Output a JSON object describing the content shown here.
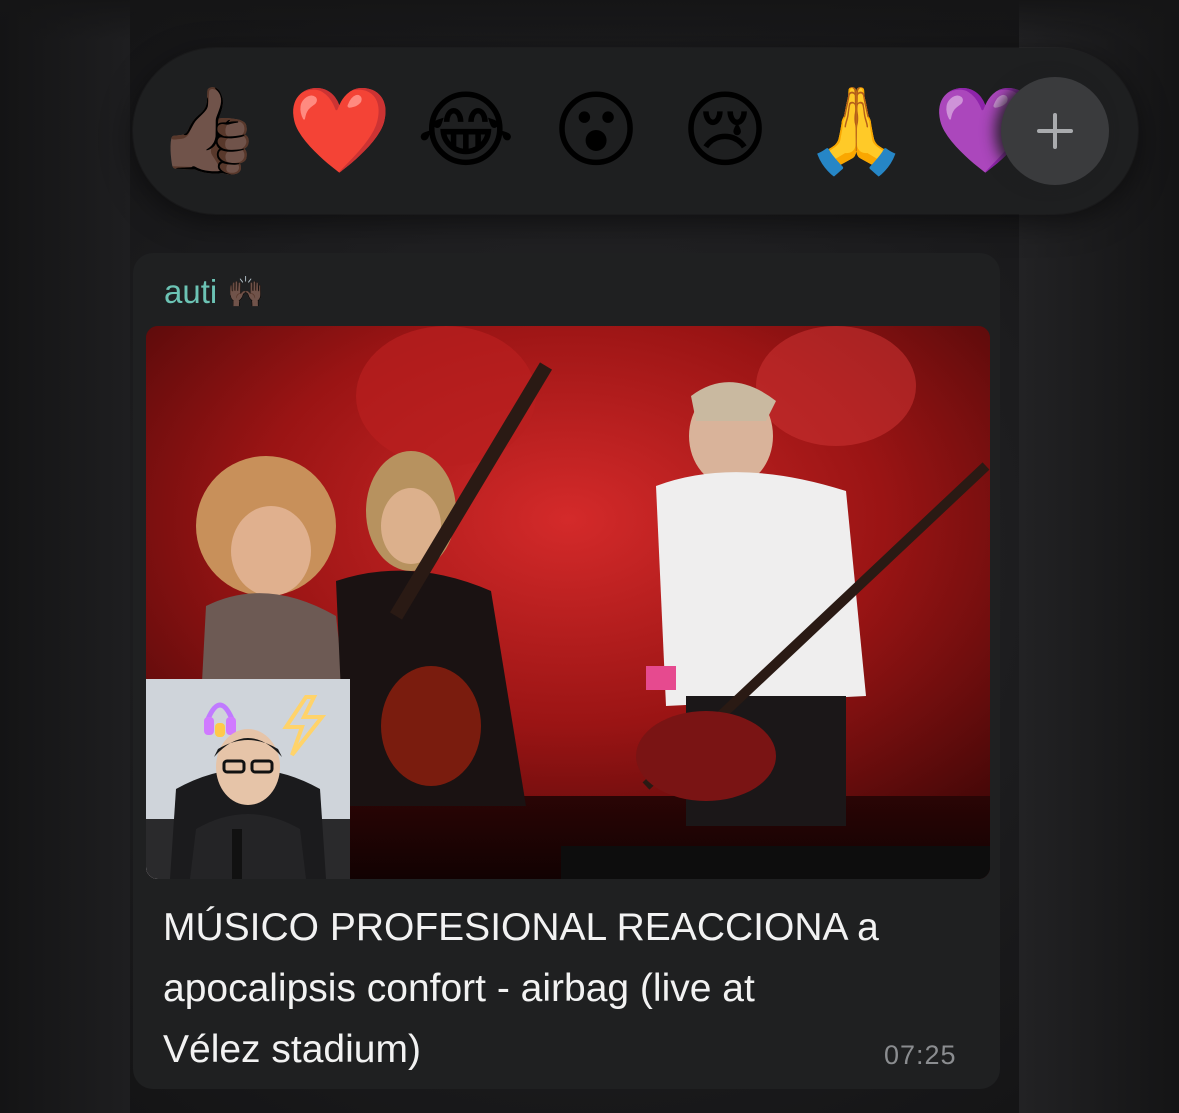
{
  "reaction_bar": {
    "reactions": [
      {
        "emoji": "👍🏿",
        "name": "thumbs-up"
      },
      {
        "emoji": "❤️",
        "name": "red-heart"
      },
      {
        "emoji": "😂",
        "name": "tears-of-joy"
      },
      {
        "emoji": "😮",
        "name": "surprised"
      },
      {
        "emoji": "😢",
        "name": "crying"
      },
      {
        "emoji": "🙏",
        "name": "folded-hands"
      },
      {
        "emoji": "💜",
        "name": "heart"
      }
    ],
    "add_icon": "plus-icon"
  },
  "message": {
    "sender": "auti",
    "sender_emoji": "🙌🏿",
    "title": "MÚSICO PROFESIONAL REACCIONA a\napocalipsis confort - airbag (live at\nVélez stadium)",
    "time": "07:25"
  },
  "colors": {
    "sender": "#6cc3b4",
    "bubble": "#1f2021",
    "bar": "#1e1f20"
  }
}
